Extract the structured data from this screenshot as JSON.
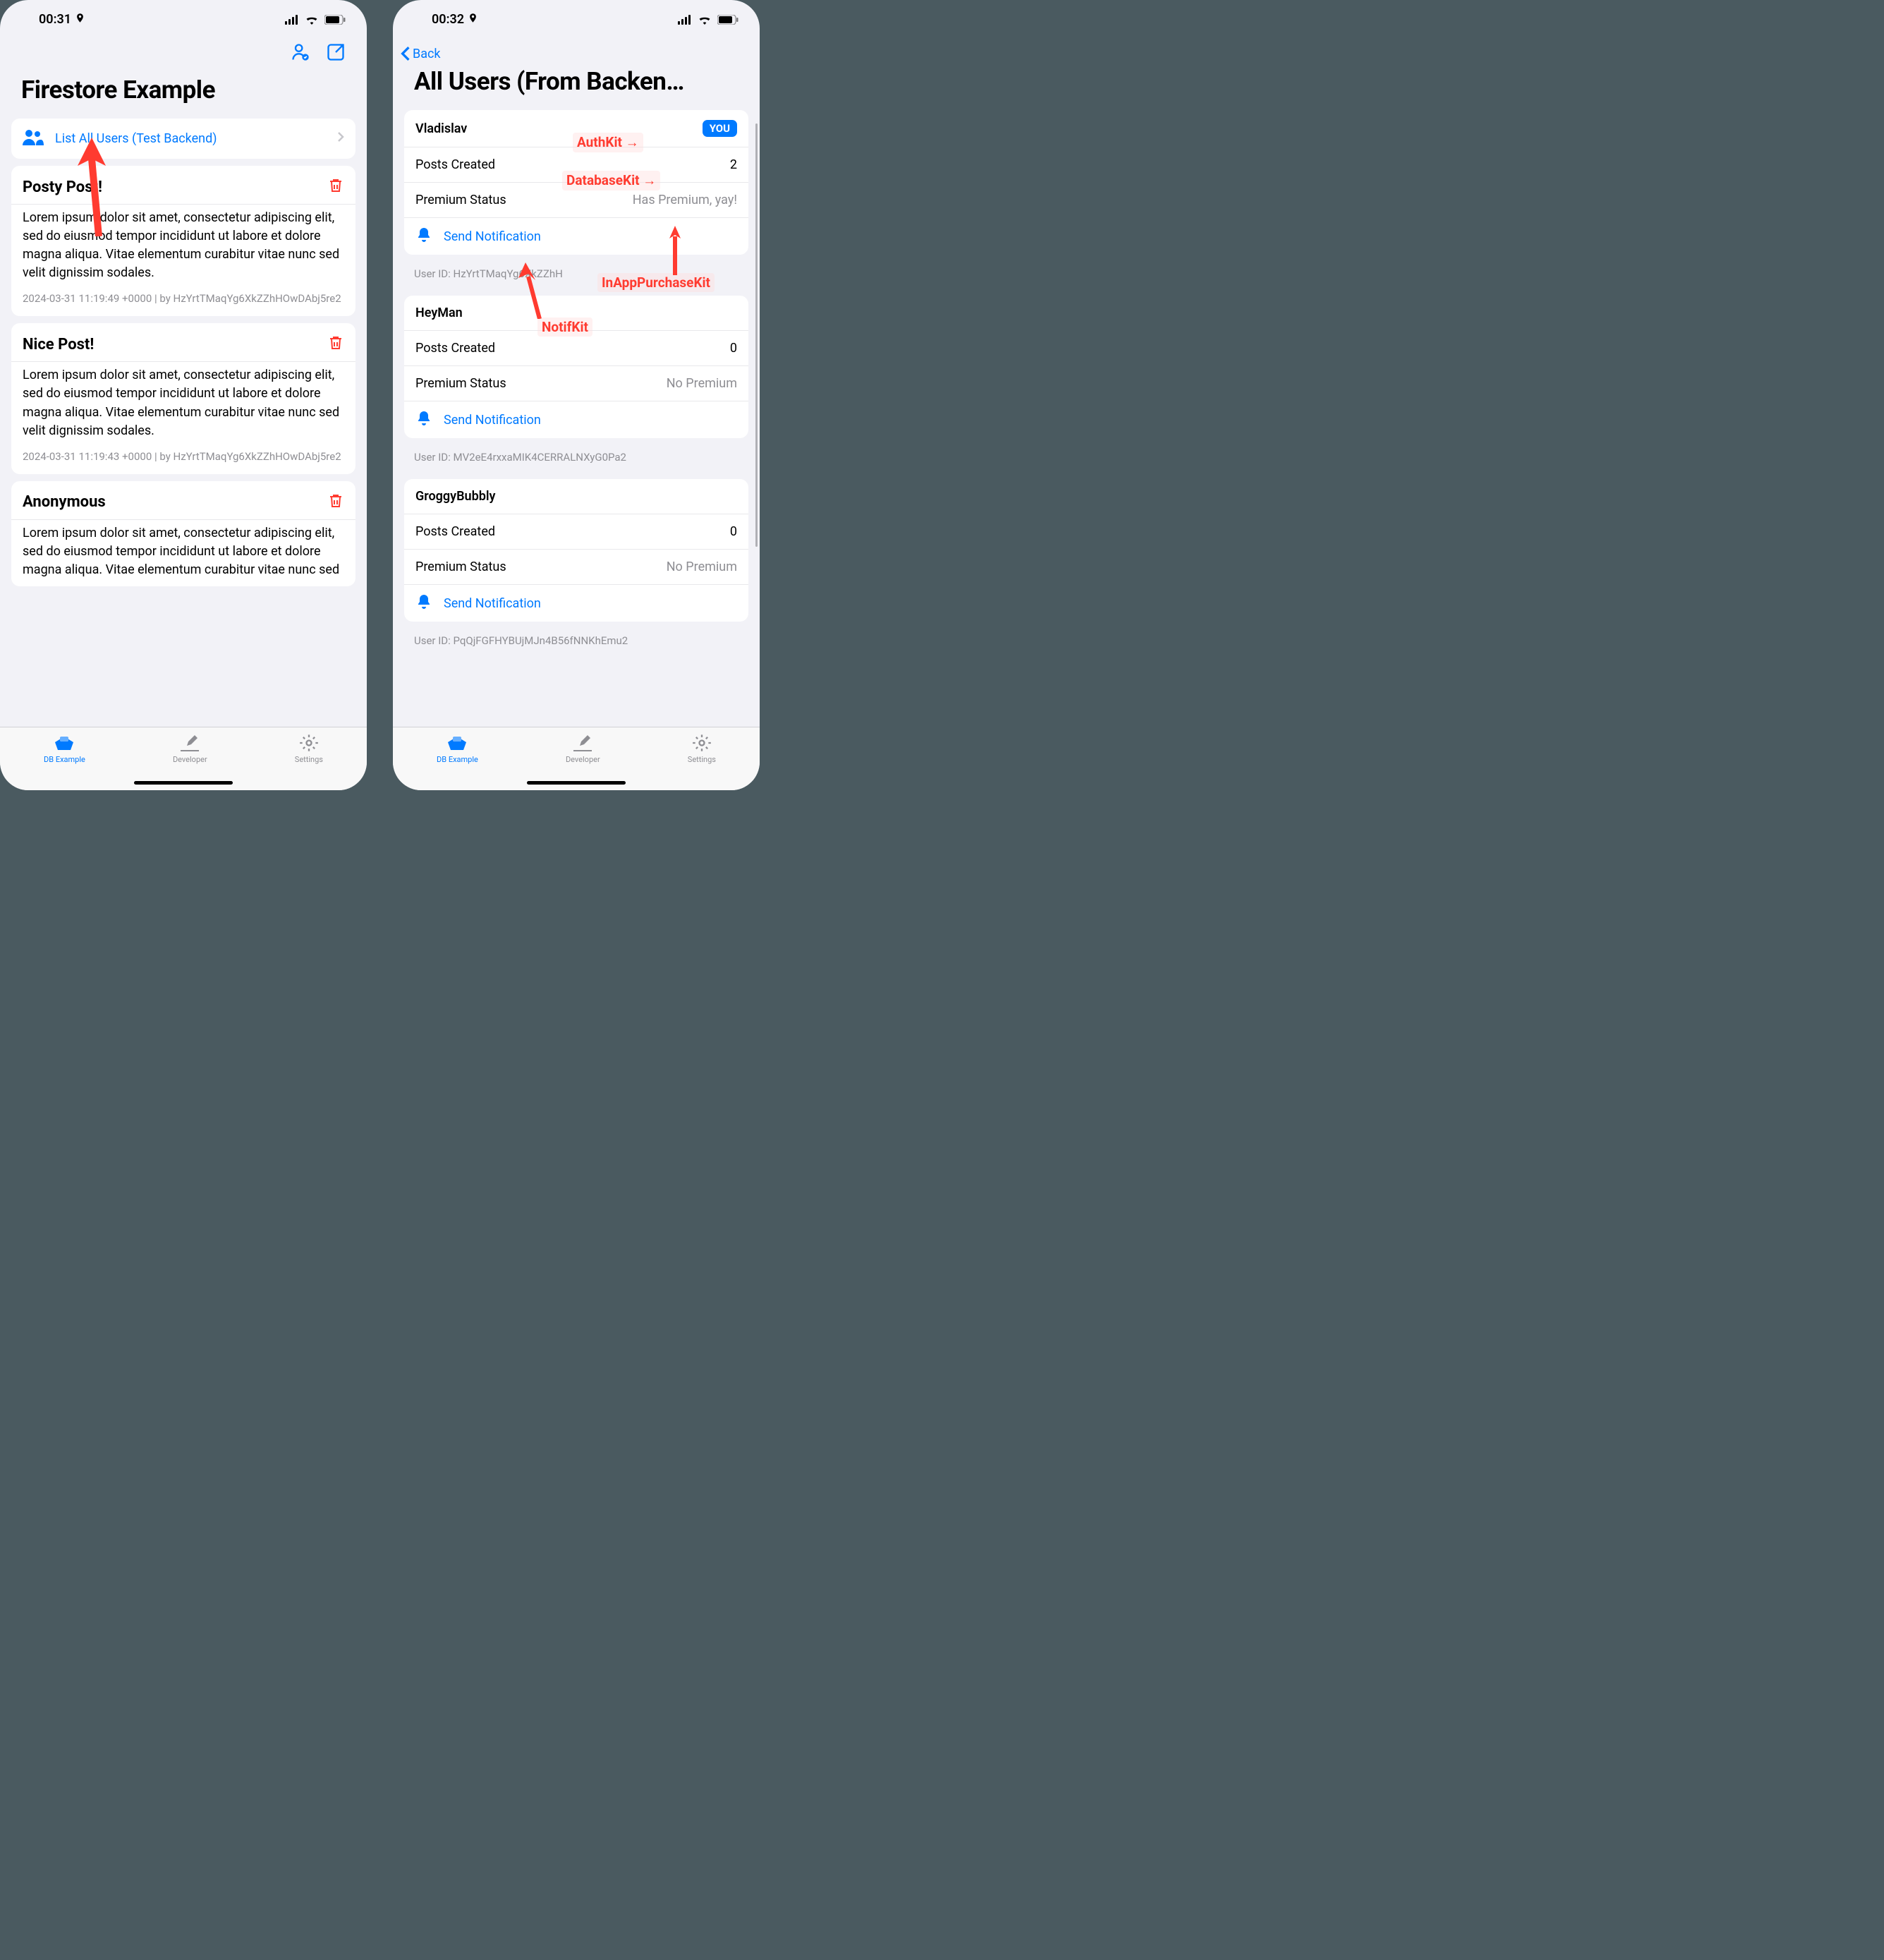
{
  "left": {
    "status_time": "00:31",
    "title": "Firestore Example",
    "list_users_label": "List All Users (Test Backend)",
    "posts": [
      {
        "title": "Posty Post!",
        "body": "Lorem ipsum dolor sit amet, consectetur adipiscing elit, sed do eiusmod tempor incididunt ut labore et dolore magna aliqua. Vitae elementum curabitur vitae nunc sed velit dignissim sodales.",
        "meta": "2024-03-31 11:19:49 +0000 | by HzYrtTMaqYg6XkZZhHOwDAbj5re2"
      },
      {
        "title": "Nice Post!",
        "body": "Lorem ipsum dolor sit amet, consectetur adipiscing elit, sed do eiusmod tempor incididunt ut labore et dolore magna aliqua. Vitae elementum curabitur vitae nunc sed velit dignissim sodales.",
        "meta": "2024-03-31 11:19:43 +0000 | by HzYrtTMaqYg6XkZZhHOwDAbj5re2"
      },
      {
        "title": "Anonymous",
        "body": "Lorem ipsum dolor sit amet, consectetur adipiscing elit, sed do eiusmod tempor incididunt ut labore et dolore magna aliqua. Vitae elementum curabitur vitae nunc sed",
        "meta": ""
      }
    ]
  },
  "right": {
    "status_time": "00:32",
    "back_label": "Back",
    "title": "All Users (From Backen…",
    "you_badge": "YOU",
    "send_notif_label": "Send Notification",
    "users": [
      {
        "name": "Vladislav",
        "posts": "2",
        "premium": "Has Premium, yay!",
        "id": "User ID: HzYrtTMaqYg6XkZZhH"
      },
      {
        "name": "HeyMan",
        "posts": "0",
        "premium": "No Premium",
        "id": "User ID: MV2eE4rxxaMIK4CERRALNXyG0Pa2"
      },
      {
        "name": "GroggyBubbly",
        "posts": "0",
        "premium": "No Premium",
        "id": "User ID: PqQjFGFHYBUjMJn4B56fNNKhEmu2"
      }
    ],
    "labels": {
      "posts": "Posts Created",
      "premium": "Premium Status"
    }
  },
  "tabs": [
    {
      "label": "DB Example"
    },
    {
      "label": "Developer"
    },
    {
      "label": "Settings"
    }
  ],
  "annotations": {
    "authkit": "AuthKit →",
    "databasekit": "DatabaseKit →",
    "iap": "InAppPurchaseKit",
    "notifkit": "NotifKit"
  }
}
